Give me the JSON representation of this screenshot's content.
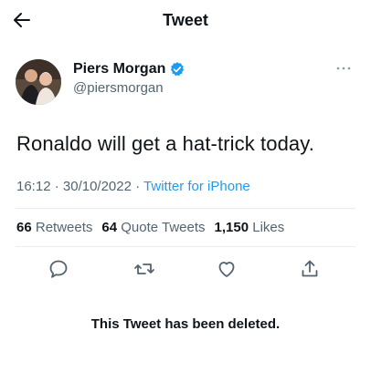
{
  "header": {
    "title": "Tweet"
  },
  "tweet": {
    "author_name": "Piers Morgan",
    "author_handle": "@piersmorgan",
    "text": "Ronaldo will get a hat-trick today.",
    "time": "16:12",
    "date": "30/10/2022",
    "separator1": "·",
    "separator2": "·",
    "source": "Twitter for iPhone"
  },
  "stats": {
    "retweets_count": "66",
    "retweets_label": "Retweets",
    "quote_count": "64",
    "quote_label": "Quote Tweets",
    "likes_count": "1,150",
    "likes_label": "Likes"
  },
  "icons": {
    "back": "arrow-left-icon",
    "verified": "verified-badge-icon",
    "more": "more-dots-icon",
    "reply": "reply-icon",
    "retweet": "retweet-icon",
    "like": "heart-icon",
    "share": "share-icon"
  },
  "colors": {
    "accent": "#1d9bf0",
    "secondary_text": "#536471"
  },
  "notice": {
    "deleted": "This Tweet has been deleted."
  }
}
